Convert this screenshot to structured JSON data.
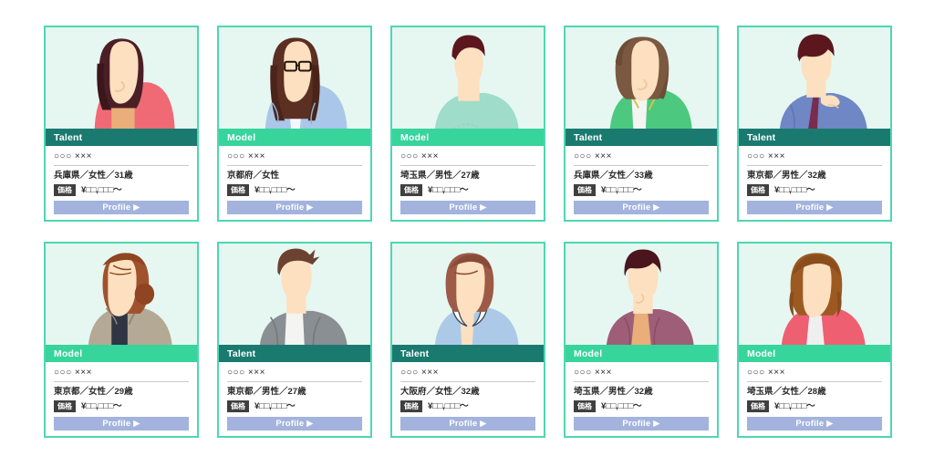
{
  "theme": {
    "card_border": "#4ed7b0",
    "photo_bg": "#e6f7f2",
    "role_talent_bg": "#1b7a70",
    "role_model_bg": "#37d49b",
    "price_badge_bg": "#3f3f3f",
    "profile_btn_bg": "#a3b3dd",
    "page_bg": "#ffffff"
  },
  "labels": {
    "price_badge": "価格",
    "profile_button": "Profile ▶",
    "name_placeholder": "○○○ ×××",
    "price_placeholder": "¥□□,□□□〜"
  },
  "cards": [
    {
      "role": "Talent",
      "role_kind": "talent",
      "name": "○○○ ×××",
      "meta": "兵庫県／女性／31歳",
      "price_label": "価格",
      "price": "¥□□,□□□〜",
      "profile": "Profile ▶",
      "avatar": "woman-long-dark-hair-pink-top"
    },
    {
      "role": "Model",
      "role_kind": "model",
      "name": "○○○ ×××",
      "meta": "京都府／女性",
      "price_label": "価格",
      "price": "¥□□,□□□〜",
      "profile": "Profile ▶",
      "avatar": "woman-glasses-blue-shirt"
    },
    {
      "role": "Model",
      "role_kind": "model",
      "name": "○○○ ×××",
      "meta": "埼玉県／男性／27歳",
      "price_label": "価格",
      "price": "¥□□,□□□〜",
      "profile": "Profile ▶",
      "avatar": "man-dark-hair-mint-tee"
    },
    {
      "role": "Talent",
      "role_kind": "talent",
      "name": "○○○ ×××",
      "meta": "兵庫県／女性／33歳",
      "price_label": "価格",
      "price": "¥□□,□□□〜",
      "profile": "Profile ▶",
      "avatar": "woman-brown-wavy-green-jacket"
    },
    {
      "role": "Talent",
      "role_kind": "talent",
      "name": "○○○ ×××",
      "meta": "東京都／男性／32歳",
      "price_label": "価格",
      "price": "¥□□,□□□〜",
      "profile": "Profile ▶",
      "avatar": "man-blue-suit-hand-chin"
    },
    {
      "role": "Model",
      "role_kind": "model",
      "name": "○○○ ×××",
      "meta": "東京都／女性／29歳",
      "price_label": "価格",
      "price": "¥□□,□□□〜",
      "profile": "Profile ▶",
      "avatar": "woman-bun-beige-blazer"
    },
    {
      "role": "Talent",
      "role_kind": "talent",
      "name": "○○○ ×××",
      "meta": "東京都／男性／27歳",
      "price_label": "価格",
      "price": "¥□□,□□□〜",
      "profile": "Profile ▶",
      "avatar": "man-spiky-hair-grey-suit"
    },
    {
      "role": "Talent",
      "role_kind": "talent",
      "name": "○○○ ×××",
      "meta": "大阪府／女性／32歳",
      "price_label": "価格",
      "price": "¥□□,□□□〜",
      "profile": "Profile ▶",
      "avatar": "woman-short-bob-light-blue-blouse"
    },
    {
      "role": "Model",
      "role_kind": "model",
      "name": "○○○ ×××",
      "meta": "埼玉県／男性／32歳",
      "price_label": "価格",
      "price": "¥□□,□□□〜",
      "profile": "Profile ▶",
      "avatar": "man-dark-hair-plum-jacket"
    },
    {
      "role": "Model",
      "role_kind": "model",
      "name": "○○○ ×××",
      "meta": "埼玉県／女性／28歳",
      "price_label": "価格",
      "price": "¥□□,□□□〜",
      "profile": "Profile ▶",
      "avatar": "woman-auburn-hair-pink-cardigan"
    }
  ]
}
